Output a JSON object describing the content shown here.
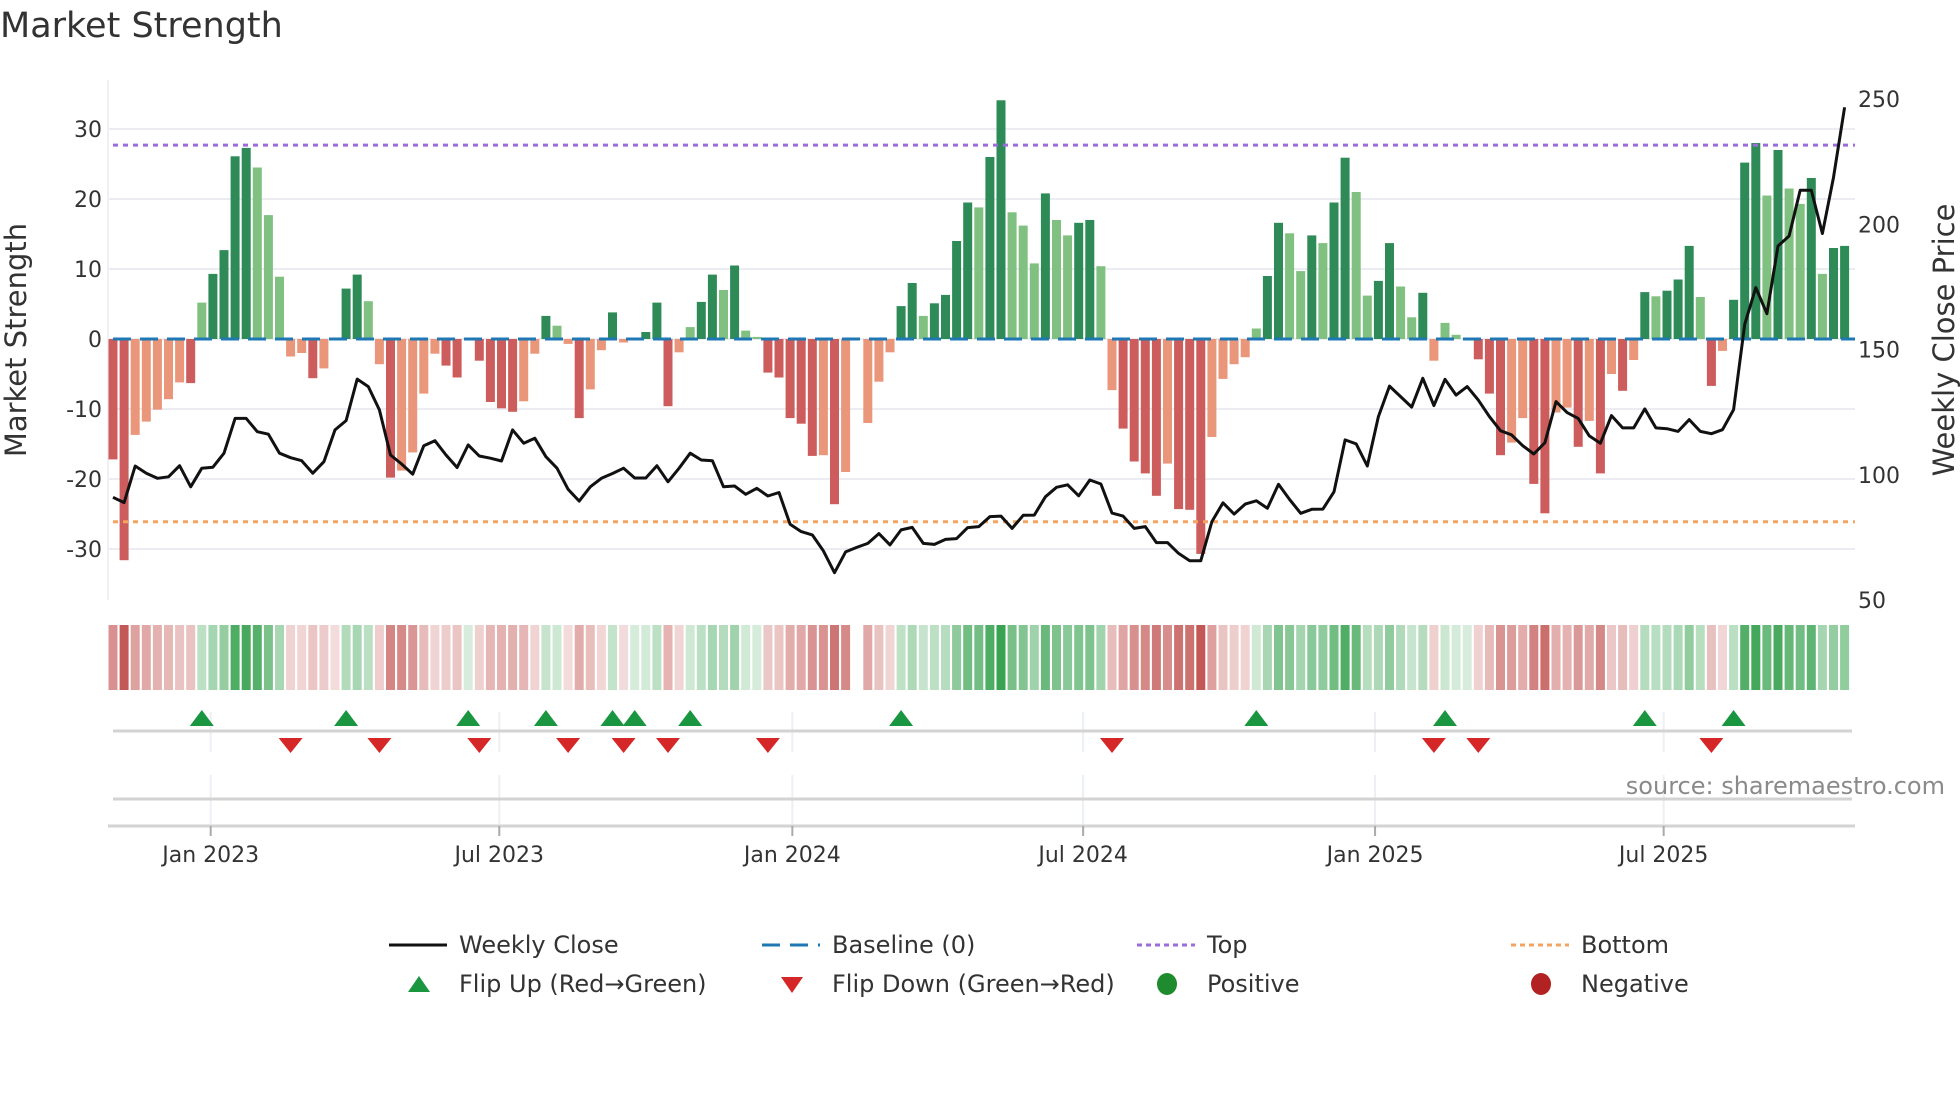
{
  "title": "Market Strength",
  "source_note": "source: sharemaestro.com",
  "colors": {
    "strong_green": "#2e8b57",
    "weak_green": "#80c080",
    "strong_red": "#cd5c5c",
    "weak_red": "#e9967a",
    "baseline": "#1f77b4",
    "top": "#9b6ddb",
    "bottom": "#f4a460",
    "flip_up": "#1a9641",
    "flip_down": "#d62728",
    "positive": "#1e8c2e",
    "negative": "#b22222"
  },
  "legend": [
    {
      "label": "Weekly Close",
      "kind": "line"
    },
    {
      "label": "Baseline (0)",
      "kind": "baseline"
    },
    {
      "label": "Top",
      "kind": "top"
    },
    {
      "label": "Bottom",
      "kind": "bottom"
    },
    {
      "label": "Flip Up (Red→Green)",
      "kind": "up"
    },
    {
      "label": "Flip Down (Green→Red)",
      "kind": "down"
    },
    {
      "label": "Positive",
      "kind": "pos"
    },
    {
      "label": "Negative",
      "kind": "neg"
    }
  ],
  "chart_data": {
    "type": "bar",
    "title": "Market Strength",
    "ylabel": "Market Strength",
    "y2label": "Weekly Close Price",
    "ylim": [
      -34,
      38
    ],
    "y2lim": [
      50,
      250
    ],
    "yticks": [
      30,
      20,
      10,
      0,
      -10,
      -20,
      -30
    ],
    "y2ticks": [
      250,
      200,
      150,
      100,
      50
    ],
    "top_level": 27.7,
    "bottom_level": -26.1,
    "xticks": [
      {
        "label": "Jan 2023",
        "week": 9.8
      },
      {
        "label": "Jul 2023",
        "week": 35.8
      },
      {
        "label": "Jan 2024",
        "week": 62.2
      },
      {
        "label": "Jul 2024",
        "week": 88.4
      },
      {
        "label": "Jan 2025",
        "week": 114.7
      },
      {
        "label": "Jul 2025",
        "week": 140.7
      }
    ],
    "strength": [
      -17.2,
      -31.6,
      -13.7,
      -11.8,
      -10.1,
      -8.6,
      -6.2,
      -6.3,
      5.2,
      9.3,
      12.7,
      26.1,
      27.3,
      24.5,
      17.7,
      8.9,
      -2.5,
      -2.0,
      -5.6,
      -4.2,
      -0.2,
      7.2,
      9.2,
      5.4,
      -3.6,
      -19.8,
      -18.8,
      -16.2,
      -7.8,
      -2.1,
      -3.8,
      -5.5,
      0.1,
      -3.1,
      -9.0,
      -9.9,
      -10.4,
      -8.9,
      -2.1,
      3.3,
      1.9,
      -0.7,
      -11.3,
      -7.2,
      -1.6,
      3.8,
      -0.5,
      0.2,
      1.0,
      5.2,
      -9.6,
      -1.9,
      1.7,
      5.3,
      9.2,
      7.0,
      10.5,
      1.2,
      0.3,
      -4.8,
      -5.5,
      -11.3,
      -12.1,
      -16.7,
      -16.6,
      -23.6,
      -19.0,
      null,
      -12.0,
      -6.1,
      -1.9,
      4.7,
      8.0,
      3.3,
      5.1,
      6.3,
      14.0,
      19.5,
      18.8,
      26.0,
      34.1,
      18.1,
      16.2,
      10.8,
      20.8,
      17.0,
      14.8,
      16.6,
      17.0,
      10.4,
      -7.3,
      -12.8,
      -17.5,
      -19.2,
      -22.4,
      -17.8,
      -24.3,
      -24.4,
      -30.7,
      -14.0,
      -5.7,
      -3.6,
      -2.6,
      1.5,
      9.0,
      16.6,
      15.1,
      9.7,
      14.8,
      13.7,
      19.5,
      25.9,
      21.0,
      6.2,
      8.3,
      13.7,
      7.5,
      3.1,
      6.6,
      -3.1,
      2.3,
      0.6,
      0.1,
      -2.9,
      -7.8,
      -16.6,
      -14.8,
      -11.3,
      -20.7,
      -24.9,
      -10.5,
      -9.8,
      -15.4,
      -11.7,
      -19.2,
      -5.0,
      -7.4,
      -3.0,
      6.7,
      6.1,
      6.9,
      8.5,
      13.3,
      6.0,
      -6.7,
      -1.7,
      5.6,
      25.2,
      28.0,
      20.5,
      27.0,
      21.5,
      19.3,
      23.0,
      9.3,
      13.0,
      13.3
    ],
    "weekly_close": [
      91.0,
      88.9,
      103.5,
      100.6,
      98.6,
      99.2,
      103.6,
      95.2,
      102.6,
      103.0,
      108.6,
      122.5,
      122.5,
      117.2,
      116.2,
      108.6,
      106.8,
      105.6,
      100.6,
      105.2,
      117.9,
      121.6,
      138.2,
      135.2,
      125.9,
      107.9,
      104.3,
      100.2,
      111.6,
      113.6,
      107.9,
      102.9,
      111.9,
      107.5,
      106.6,
      105.5,
      117.9,
      112.6,
      114.6,
      107.2,
      102.6,
      94.2,
      89.5,
      95.2,
      98.6,
      100.5,
      102.6,
      98.7,
      98.7,
      103.6,
      97.2,
      102.6,
      108.6,
      105.9,
      105.6,
      95.2,
      95.5,
      92.2,
      94.6,
      91.5,
      92.9,
      80.2,
      77.3,
      76.0,
      69.6,
      60.9,
      69.2,
      71.0,
      72.6,
      76.5,
      72.0,
      78.0,
      79.0,
      72.6,
      72.2,
      74.2,
      74.5,
      78.9,
      79.3,
      83.3,
      83.5,
      78.6,
      83.8,
      83.9,
      91.2,
      95.0,
      96.0,
      91.6,
      97.9,
      96.3,
      84.7,
      83.5,
      78.6,
      79.3,
      72.9,
      72.9,
      68.6,
      65.7,
      65.7,
      81.3,
      88.8,
      84.3,
      88.3,
      89.6,
      86.6,
      96.2,
      90.1,
      84.6,
      86.2,
      86.3,
      93.2,
      113.9,
      112.3,
      103.5,
      123.2,
      135.4,
      131.2,
      127.0,
      138.5,
      127.6,
      138.1,
      131.8,
      135.2,
      129.8,
      123.2,
      117.6,
      115.9,
      111.6,
      108.3,
      112.8,
      129.2,
      124.8,
      122.5,
      115.5,
      112.6,
      123.6,
      118.7,
      118.7,
      126.3,
      118.7,
      118.4,
      117.3,
      122.0,
      117.3,
      116.4,
      118.0,
      126.0,
      160.0,
      174.7,
      164.3,
      191.3,
      195.3,
      213.6,
      213.6,
      196.3,
      218.7,
      246.7
    ],
    "flip_up_weeks": [
      9,
      22,
      33,
      40,
      46,
      48,
      53,
      72,
      104,
      121,
      139,
      147
    ],
    "flip_down_weeks": [
      17,
      25,
      34,
      42,
      47,
      51,
      60,
      91,
      120,
      124,
      145
    ]
  }
}
